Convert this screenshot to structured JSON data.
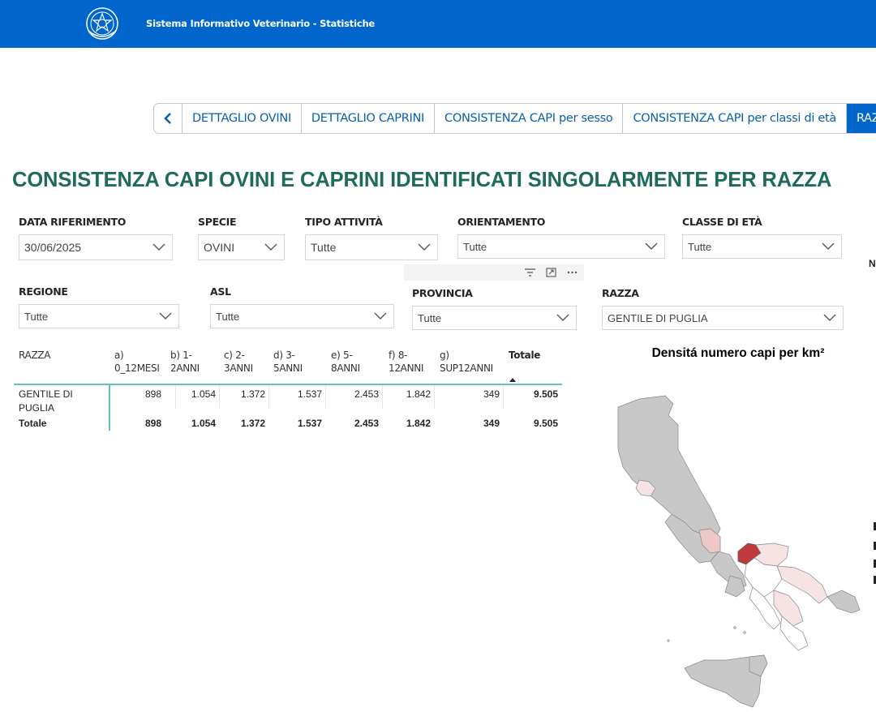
{
  "header": {
    "title": "Sistema Informativo Veterinario - Statistiche"
  },
  "tabs": [
    {
      "label": "DETTAGLIO OVINI"
    },
    {
      "label": "DETTAGLIO CAPRINI"
    },
    {
      "label": "CONSISTENZA CAPI per sesso"
    },
    {
      "label": "CONSISTENZA CAPI per classi di età"
    },
    {
      "label": "RAZZE"
    }
  ],
  "page_title": "CONSISTENZA CAPI OVINI E CAPRINI IDENTIFICATI SINGOLARMENTE PER RAZZA",
  "filters": {
    "data_riferimento": {
      "label": "DATA RIFERIMENTO",
      "value": "30/06/2025"
    },
    "specie": {
      "label": "SPECIE",
      "value": "OVINI"
    },
    "tipo_attivita": {
      "label": "TIPO ATTIVITÀ",
      "value": "Tutte"
    },
    "orientamento": {
      "label": "ORIENTAMENTO",
      "value": "Tutte"
    },
    "classe_eta": {
      "label": "CLASSE DI ETÀ",
      "value": "Tutte"
    },
    "regione": {
      "label": "REGIONE",
      "value": "Tutte"
    },
    "asl": {
      "label": "ASL",
      "value": "Tutte"
    },
    "provincia": {
      "label": "PROVINCIA",
      "value": "Tutte"
    },
    "razza": {
      "label": "RAZZA",
      "value": "GENTILE DI PUGLIA"
    }
  },
  "edge_text": {
    "n": "N"
  },
  "table": {
    "columns": [
      {
        "line1": "RAZZA",
        "line2": ""
      },
      {
        "line1": "a)",
        "line2": "0_12MESI"
      },
      {
        "line1": "b) 1-",
        "line2": "2ANNI"
      },
      {
        "line1": "c) 2-",
        "line2": "3ANNI"
      },
      {
        "line1": "d) 3-",
        "line2": "5ANNI"
      },
      {
        "line1": "e) 5-",
        "line2": "8ANNI"
      },
      {
        "line1": "f) 8-",
        "line2": "12ANNI"
      },
      {
        "line1": "g)",
        "line2": "SUP12ANNI"
      },
      {
        "line1": "Totale",
        "line2": ""
      }
    ],
    "rows": [
      {
        "name_line1": "GENTILE DI",
        "name_line2": "PUGLIA",
        "values": [
          "898",
          "1.054",
          "1.372",
          "1.537",
          "2.453",
          "1.842",
          "349",
          "9.505"
        ]
      }
    ],
    "total": {
      "label": "Totale",
      "values": [
        "898",
        "1.054",
        "1.372",
        "1.537",
        "2.453",
        "1.842",
        "349",
        "9.505"
      ]
    }
  },
  "map": {
    "title": "Densitá numero capi per km²",
    "colors": {
      "no_data": "#c8c8c8",
      "low": "#f6e3e3",
      "mid": "#eec8c8",
      "high": "#c0393b",
      "zero": "#ffffff",
      "border": "#888888"
    }
  },
  "colors": {
    "brand": "#0066cc",
    "title": "#1f6b5b",
    "accent": "#5ec3b9"
  }
}
